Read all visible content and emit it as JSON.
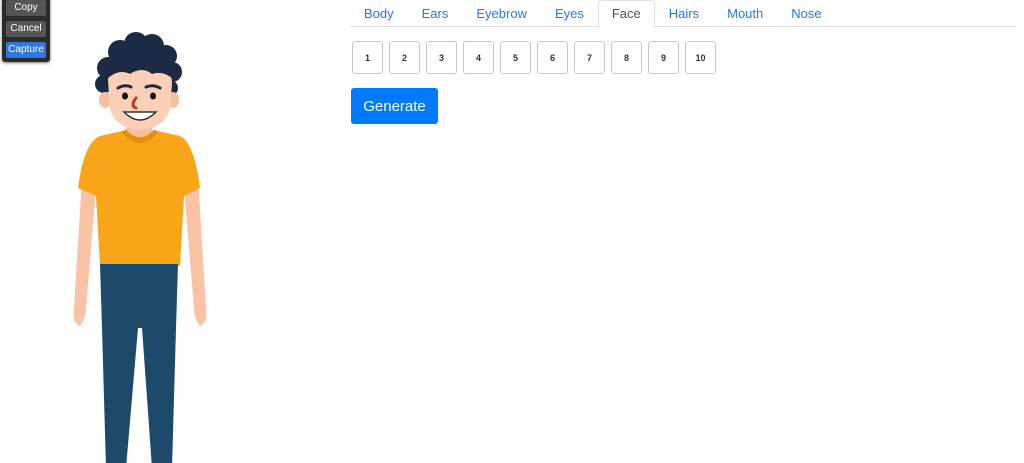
{
  "toolbar": {
    "copy_label": "Copy",
    "cancel_label": "Cancel",
    "capture_label": "Capture"
  },
  "tabs": [
    {
      "label": "Body",
      "active": false
    },
    {
      "label": "Ears",
      "active": false
    },
    {
      "label": "Eyebrow",
      "active": false
    },
    {
      "label": "Eyes",
      "active": false
    },
    {
      "label": "Face",
      "active": true
    },
    {
      "label": "Hairs",
      "active": false
    },
    {
      "label": "Mouth",
      "active": false
    },
    {
      "label": "Nose",
      "active": false
    }
  ],
  "options": [
    "1",
    "2",
    "3",
    "4",
    "5",
    "6",
    "7",
    "8",
    "9",
    "10"
  ],
  "generate_label": "Generate",
  "colors": {
    "accent": "#007bff",
    "tab_link": "#1a7cf3",
    "shirt": "#f9a51a",
    "pants": "#1d4a6b",
    "skin": "#fbd0b6",
    "hair": "#1c2a45"
  }
}
